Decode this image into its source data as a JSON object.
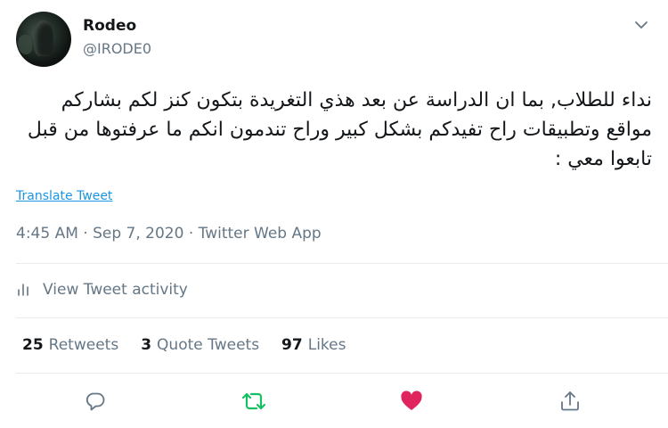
{
  "user": {
    "display_name": "Rodeo",
    "handle": "@IRODE0"
  },
  "tweet": {
    "text": "نداء للطلاب, بما ان الدراسة عن بعد هذي التغريدة بتكون كنز لكم بشاركم مواقع وتطبيقات راح تفيدكم بشكل كبير وراح تندمون انكم ما عرفتوها من قبل تابعوا معي :",
    "translate_label": "Translate Tweet",
    "meta": "4:45 AM · Sep 7, 2020 · Twitter Web App"
  },
  "activity": {
    "label": "View Tweet activity",
    "icon": "bar-chart-icon"
  },
  "stats": {
    "retweets_count": "25",
    "retweets_label": "Retweets",
    "quotes_count": "3",
    "quotes_label": "Quote Tweets",
    "likes_count": "97",
    "likes_label": "Likes"
  },
  "actions": {
    "reply_icon": "reply-icon",
    "retweet_icon": "retweet-icon",
    "like_icon": "heart-icon",
    "share_icon": "share-icon",
    "retweet_color": "#17bf63",
    "like_color": "#e0245e",
    "neutral_color": "#657786"
  }
}
